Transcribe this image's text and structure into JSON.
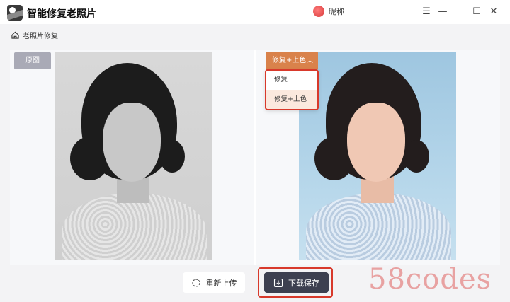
{
  "app": {
    "title": "智能修复老照片",
    "user_name": "昵称"
  },
  "window_controls": {
    "menu": "☰",
    "minimize": "—",
    "maximize": "☐",
    "close": "✕"
  },
  "breadcrumb": {
    "label": "老照片修复"
  },
  "compare": {
    "original_label": "原图",
    "mode_selected": "修复+上色",
    "mode_options": [
      "修复",
      "修复+上色"
    ],
    "active_option_index": 1
  },
  "actions": {
    "reupload_label": "重新上传",
    "download_label": "下载保存"
  },
  "watermark": "58codes",
  "colors": {
    "accent": "#d9824b",
    "primary_button": "#3d4050",
    "highlight": "#d8392b"
  }
}
